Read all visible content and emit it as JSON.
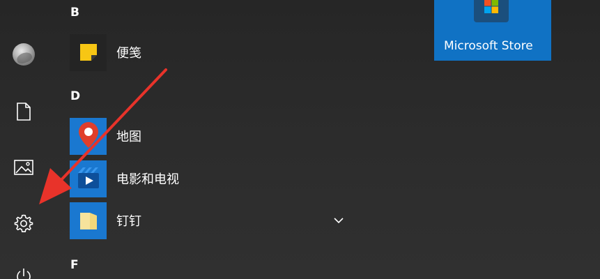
{
  "letters": {
    "b": "B",
    "d": "D",
    "f": "F"
  },
  "apps": [
    {
      "label": "便笺",
      "icon": "sticky-notes-icon",
      "color": "#f7c614"
    },
    {
      "label": "地图",
      "icon": "maps-icon",
      "color": "#1a78d0"
    },
    {
      "label": "电影和电视",
      "icon": "movies-tv-icon",
      "color": "#1a78d0"
    },
    {
      "label": "钉钉",
      "icon": "folder-icon",
      "color": "#1a78d0"
    }
  ],
  "tile": {
    "label": "Microsoft Store",
    "color": "#1072c4",
    "icon": "store-icon"
  },
  "rail": [
    "avatar",
    "document-icon",
    "pictures-icon",
    "gear-icon",
    "power-icon"
  ],
  "annotation": {
    "arrow_color": "#e8332a",
    "points_to": "gear-icon"
  }
}
